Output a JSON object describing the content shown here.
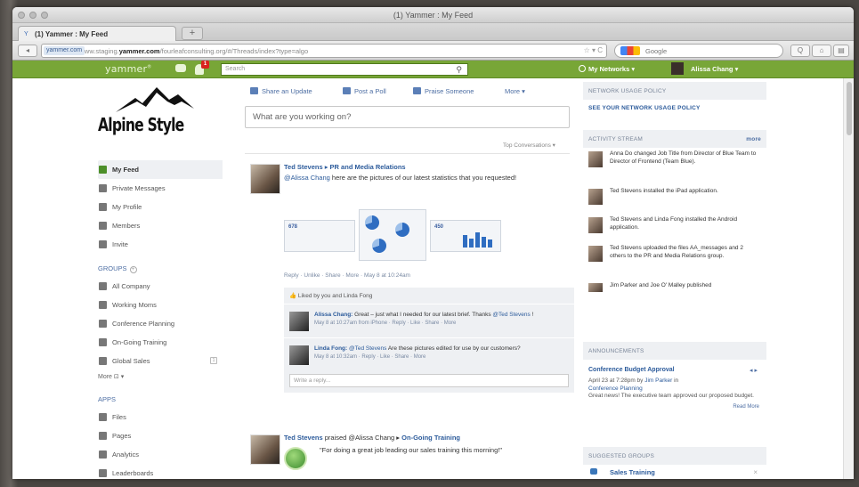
{
  "window": {
    "title": "(1) Yammer : My Feed"
  },
  "browser": {
    "tab_label": "(1) Yammer : My Feed",
    "tab_favicon": "Y",
    "new_tab": "+",
    "url_badge": "yammer.com",
    "url_prefix": "https://www.staging.",
    "url_domain": "yammer.com",
    "url_path": "/fourleafconsulting.org/#/Threads/index?type=algo",
    "url_controls": "☆ ▾ C",
    "search_placeholder": "Google",
    "back": "◂",
    "search_btn": "Q",
    "home_btn": "⌂",
    "menu_btn": "▤"
  },
  "header": {
    "logo": "yammer",
    "logo_mark": "®",
    "notif_count": "1",
    "search_placeholder": "Search",
    "networks": "My Networks ▾",
    "user": "Alissa Chang ▾"
  },
  "brand": {
    "name": "Alpine Style"
  },
  "sidebar": {
    "items": [
      {
        "label": "My Feed"
      },
      {
        "label": "Private Messages"
      },
      {
        "label": "My Profile"
      },
      {
        "label": "Members"
      },
      {
        "label": "Invite"
      }
    ],
    "groups_heading": "GROUPS",
    "groups_add": "+",
    "groups": [
      {
        "label": "All Company"
      },
      {
        "label": "Working Moms"
      },
      {
        "label": "Conference Planning"
      },
      {
        "label": "On-Going Training"
      },
      {
        "label": "Global Sales",
        "count": "1"
      }
    ],
    "groups_more": "More ⊡ ▾",
    "apps_heading": "APPS",
    "apps": [
      {
        "label": "Files"
      },
      {
        "label": "Pages"
      },
      {
        "label": "Analytics"
      },
      {
        "label": "Leaderboards"
      }
    ]
  },
  "main": {
    "actions": {
      "share": "Share an Update",
      "poll": "Post a Poll",
      "praise": "Praise Someone",
      "more": "More ▾"
    },
    "composer_placeholder": "What are you working on?",
    "top_conversations": "Top Conversations ▾",
    "post1": {
      "author": "Ted Stevens ▸ PR and Media Relations",
      "mention": "@Alissa Chang",
      "text": " here are the pictures of our latest statistics that you requested!",
      "thumb1_num": "678",
      "thumb3_num": "450",
      "meta": "Reply · Unlike · Share · More · May 8 at 10:24am",
      "liked": "Liked by you and Linda Fong",
      "reply1": {
        "author": "Alissa Chang:",
        "text": " Great – just what I needed for our latest brief. Thanks ",
        "mention": "@Ted Stevens",
        "tail": " !",
        "meta": "May 8 at 10:27am from iPhone · Reply · Like · Share · More"
      },
      "reply2": {
        "author": "Linda Fong:",
        "mention": "@Ted Stevens",
        "text": " Are these pictures edited for use by our customers?",
        "meta": "May 8 at 10:32am · Reply · Like · Share · More"
      },
      "reply_placeholder": "Write a reply..."
    },
    "post2": {
      "author": "Ted Stevens",
      "mid": " praised @Alissa Chang ▸ ",
      "group": "On-Going Training",
      "quote": "\"For doing a great job leading our sales training this morning!\""
    }
  },
  "right": {
    "policy_heading": "NETWORK USAGE POLICY",
    "policy_link": "SEE YOUR NETWORK USAGE POLICY",
    "activity_heading": "ACTIVITY STREAM",
    "activity_more": "more",
    "activities": [
      "Anna Do changed Job Title from Director of Blue Team to Director of Frontend (Team Blue).",
      "Ted Stevens installed the iPad application.",
      "Ted Stevens and Linda Fong installed the Android application.",
      "Ted Stevens uploaded the files AA_messages and 2 others to the PR and Media Relations group.",
      "Jim Parker and Joe O' Malley published"
    ],
    "ann_heading": "ANNOUNCEMENTS",
    "ann_title": "Conference Budget Approval",
    "ann_nav": "◂ ▸",
    "ann_meta1": "April 23 at 7:28pm by ",
    "ann_meta_author": "Jim Parker",
    "ann_meta2": " in",
    "ann_group": "Conference Planning",
    "ann_text": "Great news! The executive team approved our proposed budget.",
    "ann_readmore": "Read More",
    "sugg_heading": "SUGGESTED GROUPS",
    "sugg_item": "Sales Training",
    "sugg_close": "×"
  }
}
